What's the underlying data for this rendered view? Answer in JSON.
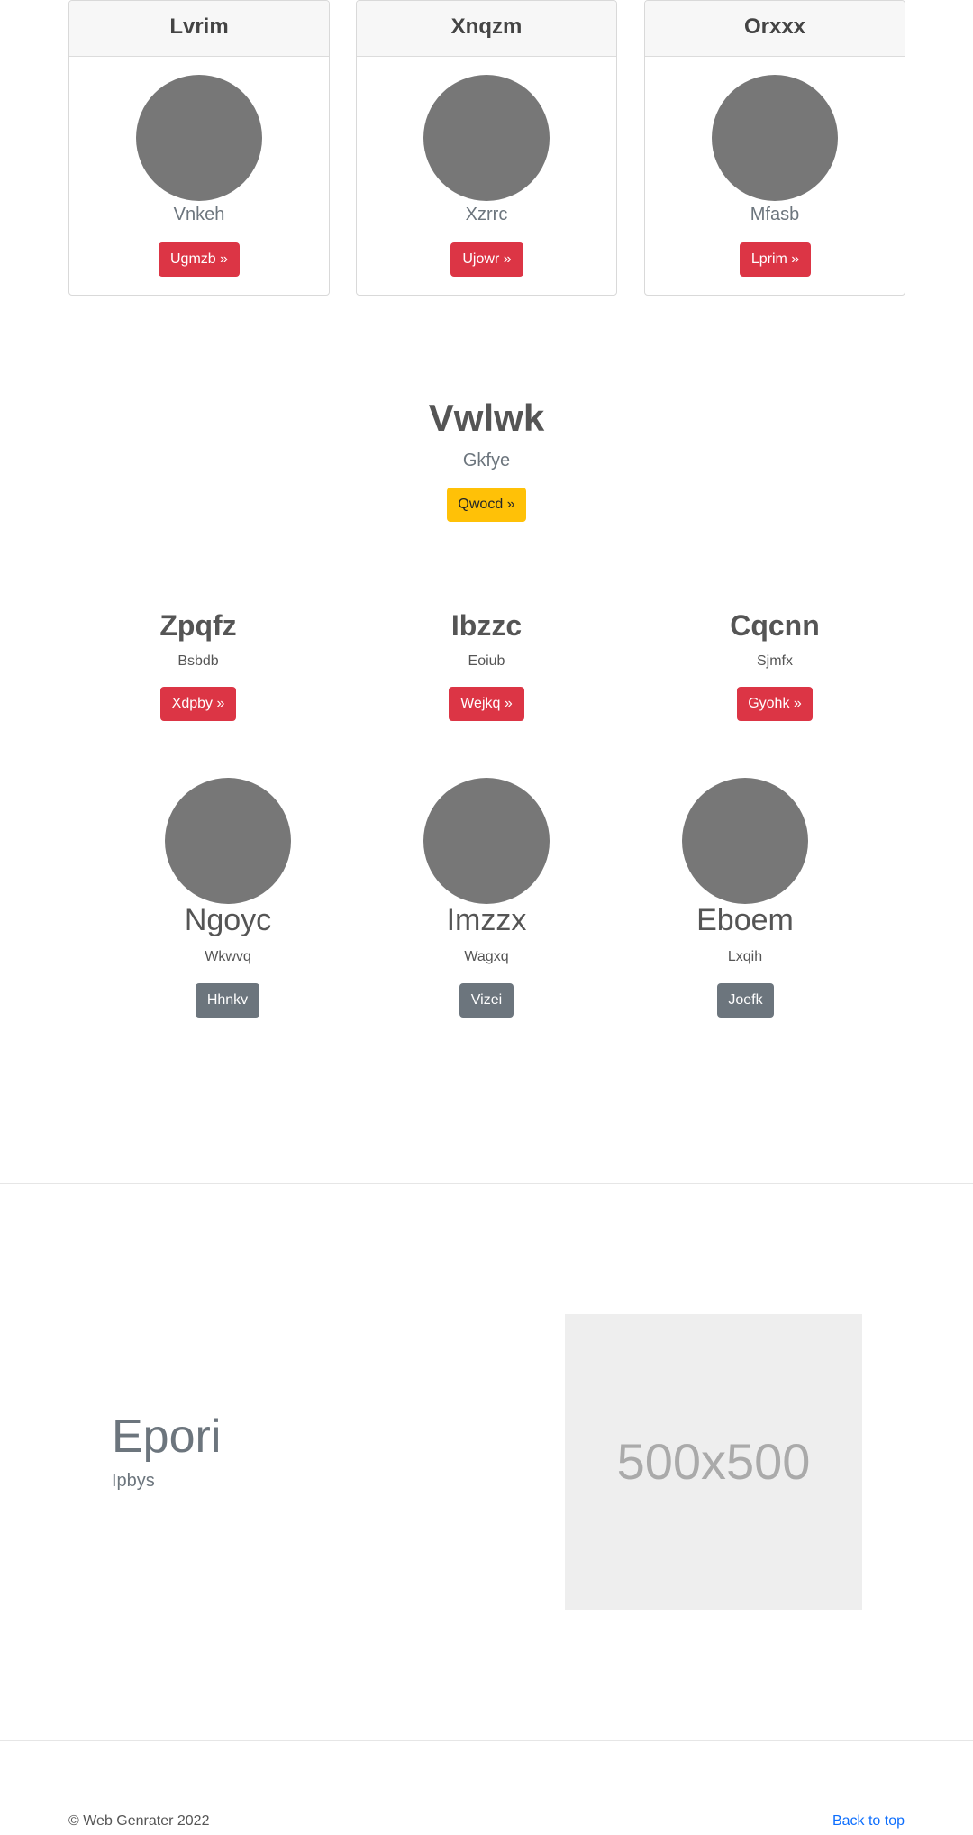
{
  "cards": [
    {
      "title": "Lvrim",
      "subtitle": "Vnkeh",
      "button": "Ugmzb »"
    },
    {
      "title": "Xnqzm",
      "subtitle": "Xzrrc",
      "button": "Ujowr »"
    },
    {
      "title": "Orxxx",
      "subtitle": "Mfasb",
      "button": "Lprim »"
    }
  ],
  "hero": {
    "title": "Vwlwk",
    "subtitle": "Gkfye",
    "button": "Qwocd »"
  },
  "columns": [
    {
      "title": "Zpqfz",
      "subtitle": "Bsbdb",
      "button": "Xdpby »"
    },
    {
      "title": "Ibzzc",
      "subtitle": "Eoiub",
      "button": "Wejkq »"
    },
    {
      "title": "Cqcnn",
      "subtitle": "Sjmfx",
      "button": "Gyohk »"
    }
  ],
  "team": [
    {
      "name": "Ngoyc",
      "subtitle": "Wkwvq",
      "button": "Hhnkv"
    },
    {
      "name": "Imzzx",
      "subtitle": "Wagxq",
      "button": "Vizei"
    },
    {
      "name": "Eboem",
      "subtitle": "Lxqih",
      "button": "Joefk"
    }
  ],
  "feature": {
    "title": "Epori",
    "subtitle": "Ipbys",
    "placeholder": "500x500"
  },
  "footer": {
    "copyright": "© Web Genrater 2022",
    "back_to_top": "Back to top"
  },
  "colors": {
    "danger": "#dc3545",
    "warning": "#ffc107",
    "secondary": "#6c757d",
    "link": "#0d6efd",
    "avatar": "#777777"
  }
}
